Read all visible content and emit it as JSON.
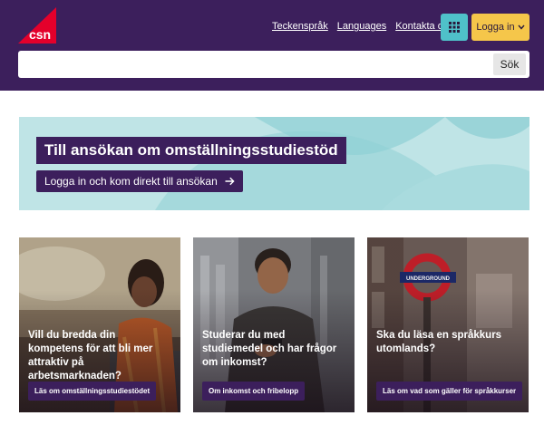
{
  "header": {
    "logo_text": "csn",
    "nav": [
      "Teckenspråk",
      "Languages",
      "Kontakta oss"
    ],
    "grid_icon": "grid-icon",
    "login_label": "Logga in",
    "login_icon": "chevron-down-icon"
  },
  "search": {
    "value": "",
    "placeholder": "",
    "button_label": "Sök"
  },
  "hero": {
    "title": "Till ansökan om omställningsstudiestöd",
    "cta_label": "Logga in och kom direkt till ansökan",
    "cta_icon": "arrow-right-icon"
  },
  "cards": [
    {
      "text": "Vill du bredda din kompetens för att bli mer attraktiv på arbetsmarknaden?",
      "button": "Läs om omställningsstudiestödet"
    },
    {
      "text": "Studerar du med studiemedel och har frågor om inkomst?",
      "button": "Om inkomst och fribelopp"
    },
    {
      "text": "Ska du läsa en språkkurs utomlands?",
      "button": "Läs om vad som gäller för språkkurser"
    }
  ],
  "colors": {
    "brand_purple": "#3c1f5c",
    "accent_teal": "#4fc1c9",
    "accent_yellow": "#f5c64a",
    "logo_red": "#e4002b"
  }
}
